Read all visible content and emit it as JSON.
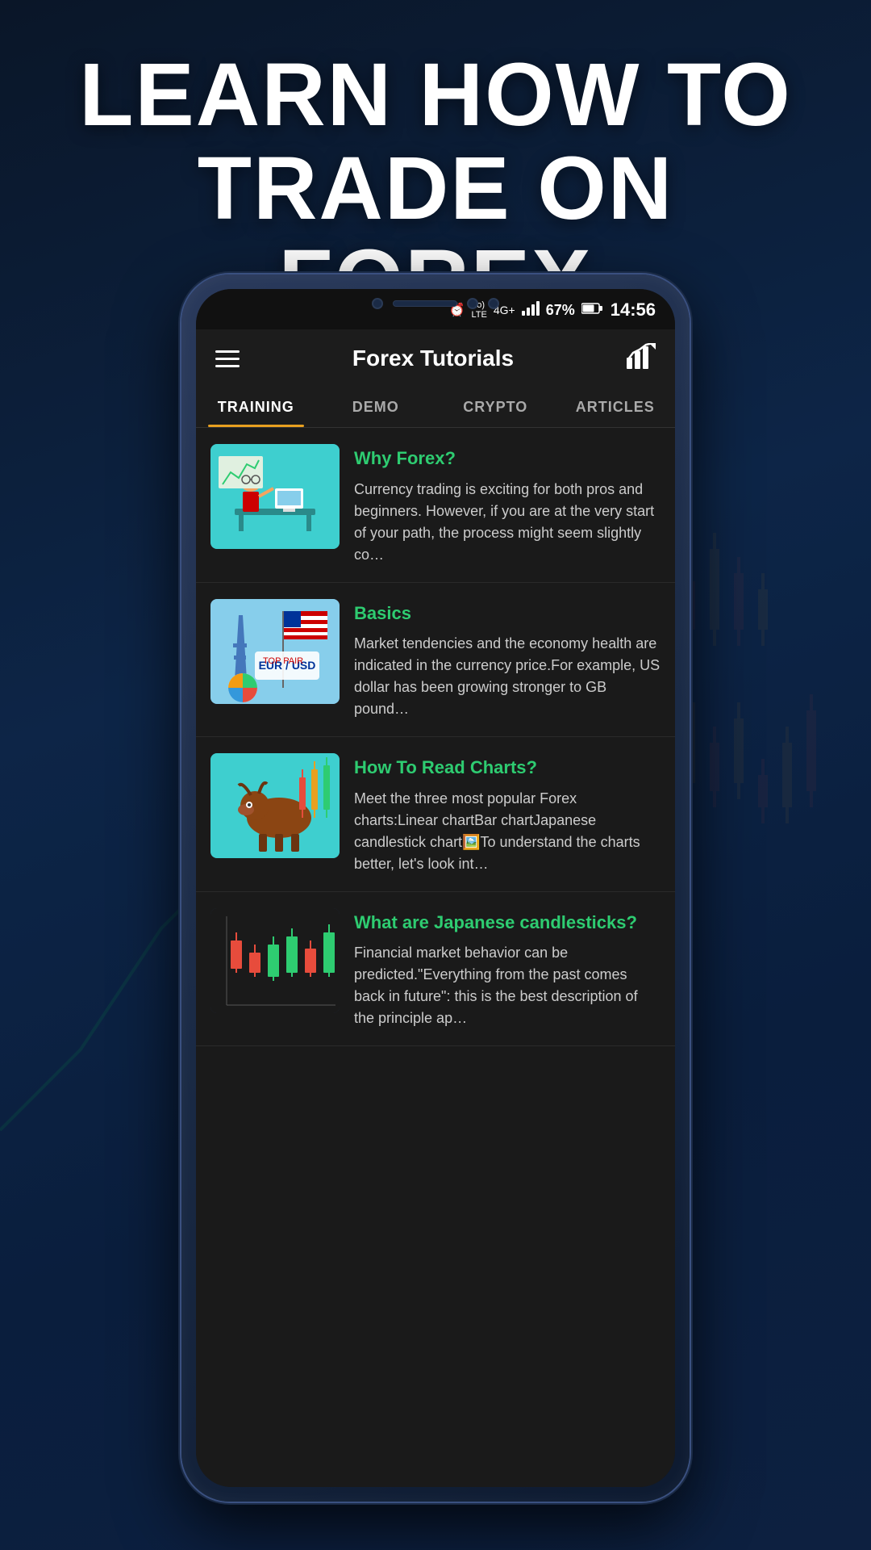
{
  "hero": {
    "title_line1": "LEARN HOW TO",
    "title_line2": "TRADE ON FOREX"
  },
  "status_bar": {
    "alarm_icon": "⏰",
    "network": "Vo) 4G+",
    "signal_icon": "📶",
    "battery_percent": "67%",
    "battery_icon": "🔋",
    "time": "14:56"
  },
  "header": {
    "menu_icon": "hamburger",
    "title": "Forex Tutorials",
    "chart_icon": "chart-icon"
  },
  "tabs": [
    {
      "label": "TRAINING",
      "active": true
    },
    {
      "label": "DEMO",
      "active": false
    },
    {
      "label": "CRYPTO",
      "active": false
    },
    {
      "label": "ARTICLES",
      "active": false
    }
  ],
  "articles": [
    {
      "title": "Why Forex?",
      "excerpt": "Currency trading is exciting for both pros and beginners. However, if you are at the very start of your path, the process might seem slightly co…",
      "thumb_type": "forex_teacher"
    },
    {
      "title": "Basics",
      "excerpt": "Market tendencies and the economy health are indicated in the currency price.For example, US dollar has been growing stronger to GB pound…",
      "thumb_type": "eur_usd"
    },
    {
      "title": "How To Read Charts?",
      "excerpt": "Meet the three most popular Forex charts:Linear chartBar chartJapanese candlestick chart🖼️To understand the charts better, let's look int…",
      "thumb_type": "bull_chart"
    },
    {
      "title": "What are Japanese candlesticks?",
      "excerpt": "Financial market behavior can be predicted.\"Everything from the past comes back in future\": this is the best description of the principle ap…",
      "thumb_type": "candlestick"
    }
  ],
  "colors": {
    "accent_green": "#2ecc71",
    "accent_orange": "#e8a020",
    "bg_dark": "#1a1a1a",
    "tab_active": "#ffffff",
    "tab_inactive": "#aaaaaa"
  }
}
